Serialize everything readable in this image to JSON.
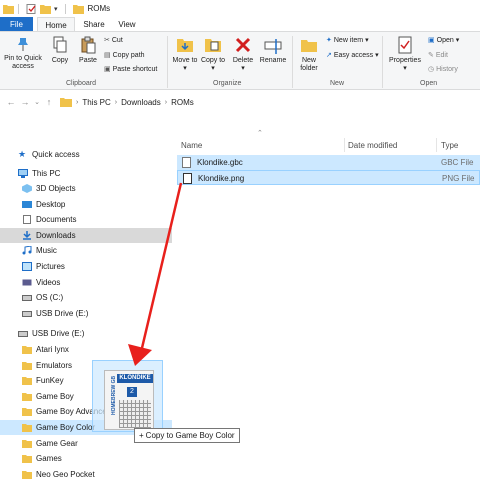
{
  "window": {
    "title": "ROMs"
  },
  "ribbon_tabs": [
    "File",
    "Home",
    "Share",
    "View"
  ],
  "ribbon": {
    "clipboard": {
      "pin": "Pin to Quick access",
      "copy": "Copy",
      "paste": "Paste",
      "cut": "Cut",
      "copy_path": "Copy path",
      "paste_shortcut": "Paste shortcut",
      "label": "Clipboard"
    },
    "organize": {
      "move_to": "Move to",
      "copy_to": "Copy to",
      "delete": "Delete",
      "rename": "Rename",
      "label": "Organize"
    },
    "new": {
      "new_folder": "New folder",
      "new_item": "New item",
      "easy_access": "Easy access",
      "label": "New"
    },
    "open": {
      "properties": "Properties",
      "open": "Open",
      "edit": "Edit",
      "history": "History",
      "label": "Open"
    }
  },
  "address": {
    "crumbs": [
      "This PC",
      "Downloads",
      "ROMs"
    ]
  },
  "nav": {
    "quick_access": "Quick access",
    "this_pc": "This PC",
    "pc_items": [
      "3D Objects",
      "Desktop",
      "Documents",
      "Downloads",
      "Music",
      "Pictures",
      "Videos",
      "OS (C:)",
      "USB Drive (E:)"
    ],
    "usb_drive": "USB Drive (E:)",
    "usb_items": [
      "Atari lynx",
      "Emulators",
      "FunKey",
      "Game Boy",
      "Game Boy Advance",
      "Game Boy Color",
      "Game Gear",
      "Games",
      "Neo Geo Pocket"
    ]
  },
  "columns": {
    "name": "Name",
    "date": "Date modified",
    "type": "Type"
  },
  "files": [
    {
      "name": "Klondike.gbc",
      "type": "GBC File"
    },
    {
      "name": "Klondike.png",
      "type": "PNG File"
    }
  ],
  "drag": {
    "tooltip_prefix": "+",
    "tooltip": "Copy to Game Boy Color",
    "thumb_title": "KLONDIKE",
    "thumb_side": "HOMEBREW GB",
    "thumb_badge": "2"
  },
  "colors": {
    "accent": "#1e6ec8",
    "selection": "#cce8ff",
    "arrow": "#e8201c",
    "folder": "#f0c24a"
  }
}
